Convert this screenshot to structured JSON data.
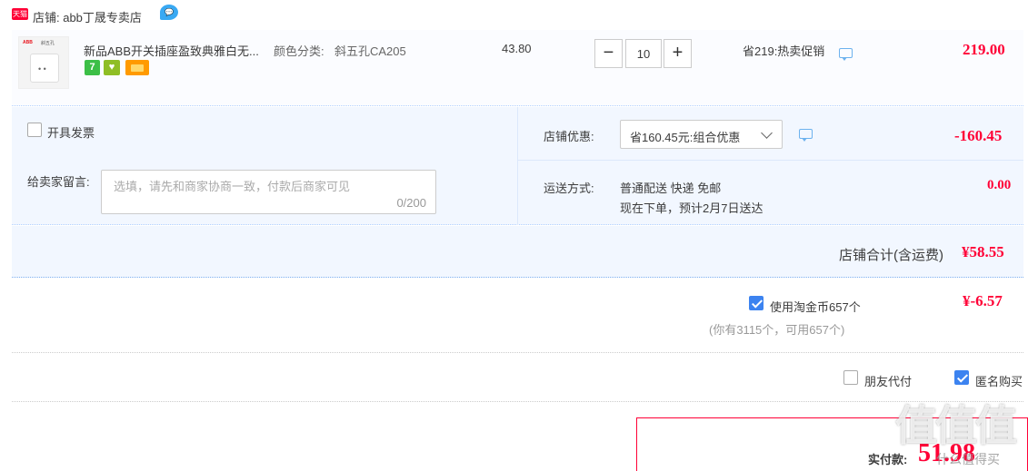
{
  "shop": {
    "badge": "天猫",
    "name": "店铺: abb丁晟专卖店",
    "wangwang_icon": "wangwang-chat-icon"
  },
  "item": {
    "thumb_brand": "ABB",
    "thumb_tag": "斜五孔",
    "title": "新品ABB开关插座盈致典雅白无...",
    "sku_label": "颜色分类:",
    "sku_value": "斜五孔CA205",
    "service_icons": [
      "7-day-return-icon",
      "guarantee-icon",
      "credit-card-icon"
    ],
    "service_badge_1": "7",
    "unit_price": "43.80",
    "quantity": "10",
    "minus_label": "−",
    "plus_label": "+",
    "promo": "省219:热卖促销",
    "total": "219.00"
  },
  "options": {
    "invoice_label": "开具发票",
    "memo_label": "给卖家留言:",
    "memo_placeholder": "选填，请先和商家协商一致，付款后商家可见",
    "memo_count": "0/200",
    "discount_label": "店铺优惠:",
    "discount_selected": "省160.45元:组合优惠",
    "discount_amount": "-160.45",
    "shipping_label": "运送方式:",
    "shipping_method": "普通配送 快递 免邮",
    "shipping_eta": "现在下单，预计2月7日送达",
    "shipping_fee": "0.00"
  },
  "shop_total": {
    "label": "店铺合计(含运费)",
    "amount": "¥58.55"
  },
  "coins": {
    "checked": true,
    "label": "使用淘金币657个",
    "amount": "¥-6.57",
    "hint": "(你有3115个，可用657个)"
  },
  "purchase_options": {
    "friend_pay_label": "朋友代付",
    "friend_pay_checked": false,
    "anonymous_label": "匿名购买",
    "anonymous_checked": true
  },
  "payment": {
    "label": "实付款:",
    "amount": "51.98"
  },
  "watermark": {
    "text": "值值值",
    "sub": "什么值得买"
  },
  "colors": {
    "accent_red": "#ff0036",
    "accent_blue": "#3c83f0",
    "panel_bg": "#f2f7ff"
  }
}
